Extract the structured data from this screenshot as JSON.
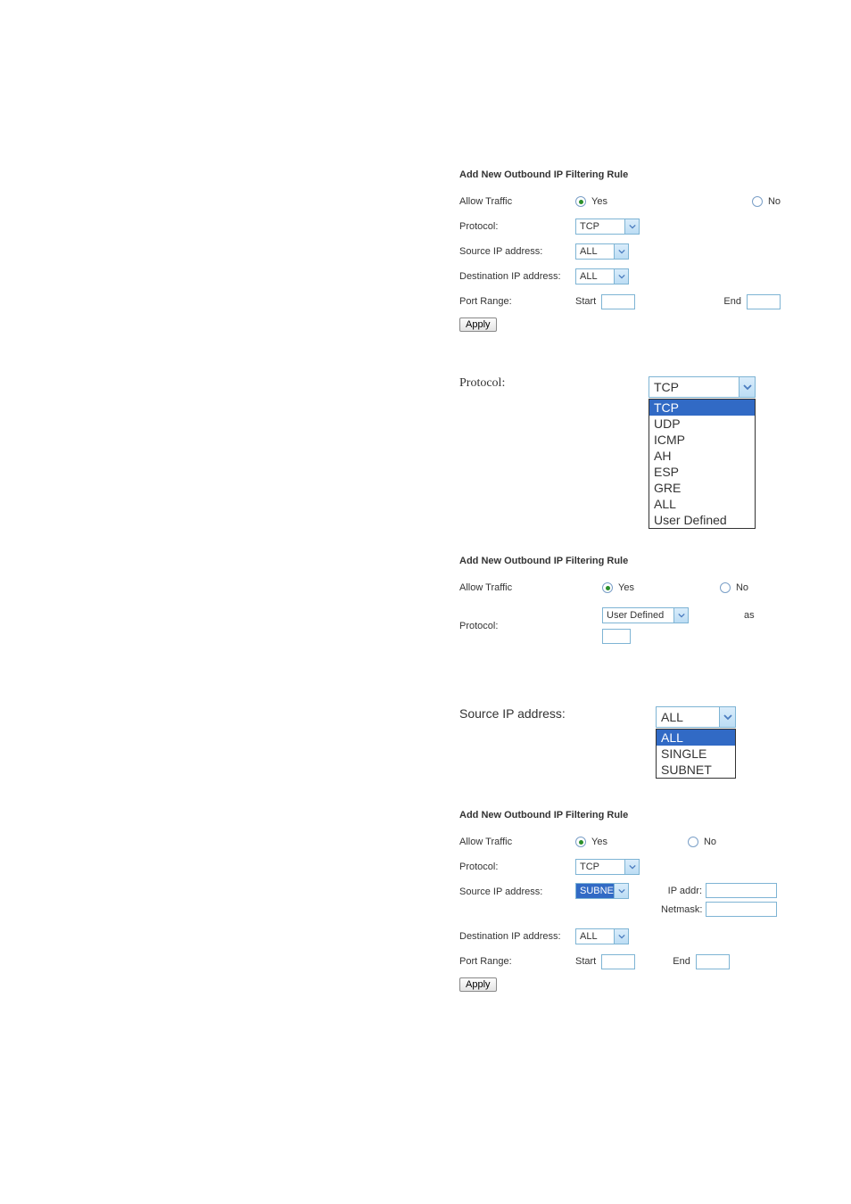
{
  "form1": {
    "heading": "Add New Outbound IP Filtering Rule",
    "allow_traffic_label": "Allow Traffic",
    "yes_label": "Yes",
    "no_label": "No",
    "protocol_label": "Protocol:",
    "protocol_value": "TCP",
    "src_ip_label": "Source IP address:",
    "src_ip_value": "ALL",
    "dst_ip_label": "Destination IP address:",
    "dst_ip_value": "ALL",
    "port_range_label": "Port Range:",
    "start_label": "Start",
    "end_label": "End",
    "apply_label": "Apply"
  },
  "proto_detail": {
    "label": "Protocol:",
    "selected": "TCP",
    "options": [
      "TCP",
      "UDP",
      "ICMP",
      "AH",
      "ESP",
      "GRE",
      "ALL",
      "User Defined"
    ]
  },
  "form2": {
    "heading": "Add New Outbound IP Filtering Rule",
    "allow_traffic_label": "Allow Traffic",
    "yes_label": "Yes",
    "no_label": "No",
    "protocol_label": "Protocol:",
    "protocol_value": "User Defined",
    "as_label": "as"
  },
  "srcip_detail": {
    "label": "Source IP address:",
    "selected": "ALL",
    "options": [
      "ALL",
      "SINGLE",
      "SUBNET"
    ]
  },
  "form3": {
    "heading": "Add New Outbound IP Filtering Rule",
    "allow_traffic_label": "Allow Traffic",
    "yes_label": "Yes",
    "no_label": "No",
    "protocol_label": "Protocol:",
    "protocol_value": "TCP",
    "src_ip_label": "Source IP address:",
    "src_ip_value": "SUBNET",
    "ipaddr_label": "IP addr:",
    "netmask_label": "Netmask:",
    "dst_ip_label": "Destination IP address:",
    "dst_ip_value": "ALL",
    "port_range_label": "Port Range:",
    "start_label": "Start",
    "end_label": "End",
    "apply_label": "Apply"
  }
}
